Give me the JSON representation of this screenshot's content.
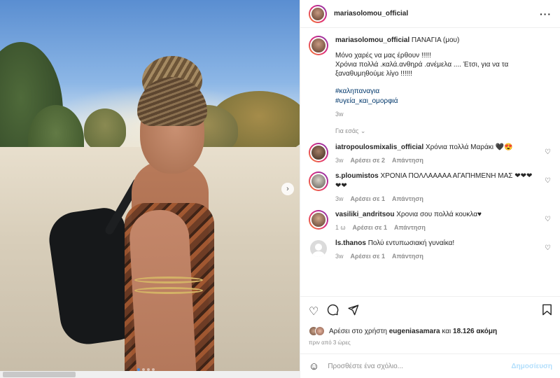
{
  "post": {
    "username": "mariasolomou_official",
    "caption_title": "ΠΑΝΑΓΙΑ (μου)",
    "caption_body": "Μόνο χαρές να μας έρθουν !!!!!\nΧρόνια πολλά .καλά.ανθηρά .ανέμελα .... Έτσι, για να τα ξαναθυμηθούμε λίγο !!!!!!",
    "hashtags": [
      "#καληπαναγια",
      "#υγεία_και_ομορφιά"
    ],
    "caption_time": "3w",
    "translate_label": "Για εσάς"
  },
  "comments": [
    {
      "username": "iatropoulosmixalis_official",
      "text": "Χρόνια πολλά Μαράκι 🖤😍",
      "time": "3w",
      "likes": "Αρέσει σε 2",
      "reply": "Απάντηση"
    },
    {
      "username": "s.ploumistos",
      "text": "ΧΡΟΝΙΑ ΠΟΛΛΑΑΑΑΑ ΑΓΑΠΗΜΕΝΗ ΜΑΣ ❤❤❤ ❤❤",
      "time": "3w",
      "likes": "Αρέσει σε 1",
      "reply": "Απάντηση"
    },
    {
      "username": "vasiliki_andritsou",
      "text": "Χρονια σου πολλά κουκλα♥",
      "time": "1 ω",
      "likes": "Αρέσει σε 1",
      "reply": "Απάντηση"
    },
    {
      "username": "ls.thanos",
      "text": "Πολύ εντυπωσιακή γυναίκα!",
      "time": "3w",
      "likes": "Αρέσει σε 1",
      "reply": "Απάντηση"
    }
  ],
  "likes": {
    "prefix": "Αρέσει στο χρήστη",
    "liker": "eugeniasamara",
    "middle": "και",
    "count": "18.126 ακόμη"
  },
  "post_time": "πριν από 3 ώρες",
  "add_comment": {
    "placeholder": "Προσθέστε ένα σχόλιο...",
    "post_label": "Δημοσίευση"
  },
  "carousel": {
    "slides": 4,
    "active": 1
  },
  "icons": {
    "more": "more-horizontal-icon",
    "heart": "heart-icon",
    "comment": "comment-icon",
    "share": "send-icon",
    "bookmark": "bookmark-icon",
    "emoji": "emoji-icon",
    "next": "chevron-right-icon"
  },
  "colors": {
    "link": "#00376b",
    "muted": "#8e8e8e",
    "post_button": "#b2dffc",
    "story_ring_start": "#f58529",
    "story_ring_end": "#8134af"
  }
}
